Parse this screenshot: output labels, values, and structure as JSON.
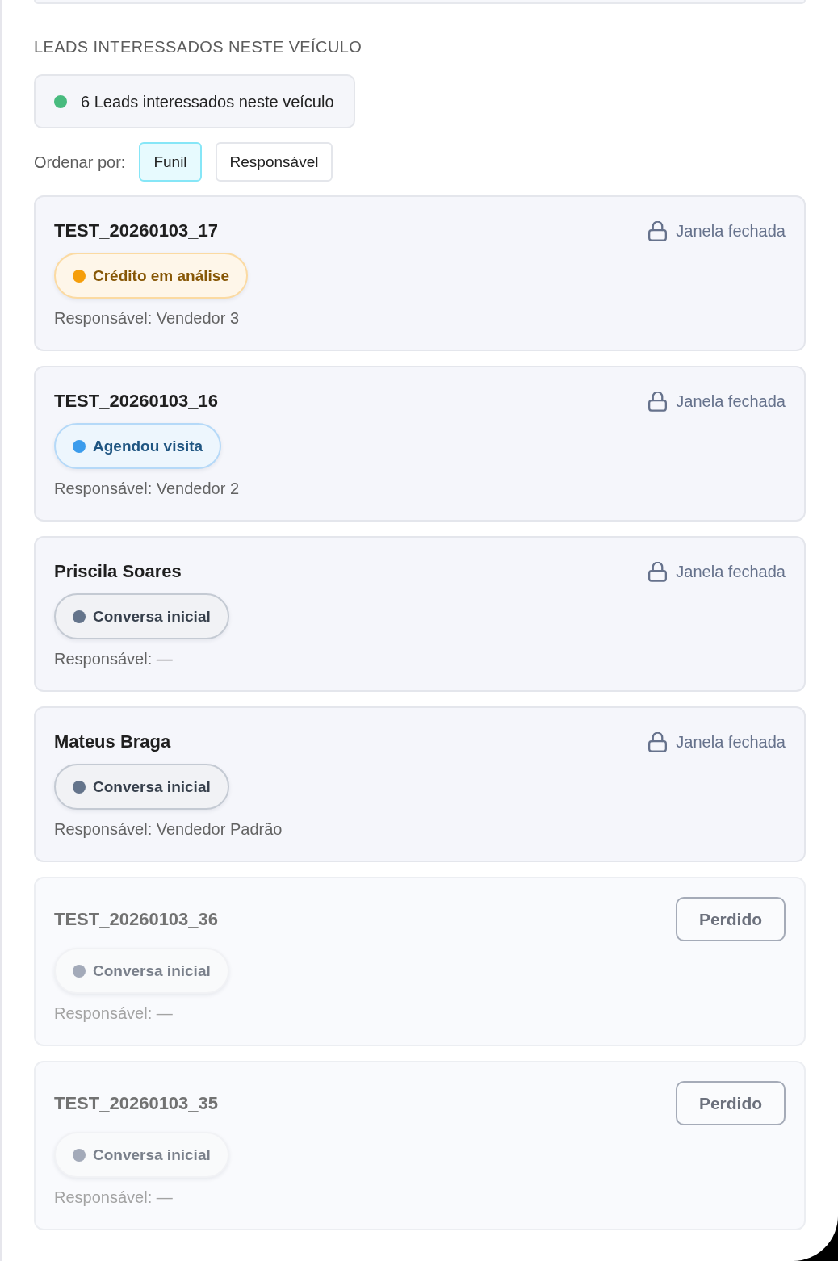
{
  "section_title": "LEADS INTERESSADOS NESTE VEÍCULO",
  "summary": {
    "text": "6 Leads interessados neste veículo"
  },
  "sort": {
    "label": "Ordenar por:",
    "options": [
      {
        "label": "Funil",
        "selected": true
      },
      {
        "label": "Responsável",
        "selected": false
      }
    ]
  },
  "leads": [
    {
      "name": "TEST_20260103_17",
      "lost": false,
      "stage": {
        "label": "Crédito em análise",
        "color": "#f59e0b"
      },
      "owner": "Responsável: Vendedor 3",
      "aside": {
        "kind": "window_note",
        "label": "Janela fechada"
      }
    },
    {
      "name": "TEST_20260103_16",
      "lost": false,
      "stage": {
        "label": "Agendou visita",
        "color": "#3b9cec"
      },
      "owner": "Responsável: Vendedor 2",
      "aside": {
        "kind": "window_note",
        "label": "Janela fechada"
      }
    },
    {
      "name": "Priscila Soares",
      "lost": false,
      "stage": {
        "label": "Conversa inicial",
        "color": "#64748b"
      },
      "owner": "Responsável: —",
      "aside": {
        "kind": "window_note",
        "label": "Janela fechada"
      }
    },
    {
      "name": "Mateus Braga",
      "lost": false,
      "stage": {
        "label": "Conversa inicial",
        "color": "#64748b"
      },
      "owner": "Responsável: Vendedor Padrão",
      "aside": {
        "kind": "window_note",
        "label": "Janela fechada"
      }
    },
    {
      "name": "TEST_20260103_36",
      "lost": true,
      "stage": {
        "label": "Conversa inicial",
        "color": "#a3aab9"
      },
      "owner": "Responsável: —",
      "aside": {
        "kind": "status_button",
        "label": "Perdido"
      }
    },
    {
      "name": "TEST_20260103_35",
      "lost": true,
      "stage": {
        "label": "Conversa inicial",
        "color": "#a3aab9"
      },
      "owner": "Responsável: —",
      "aside": {
        "kind": "status_button",
        "label": "Perdido"
      }
    }
  ]
}
